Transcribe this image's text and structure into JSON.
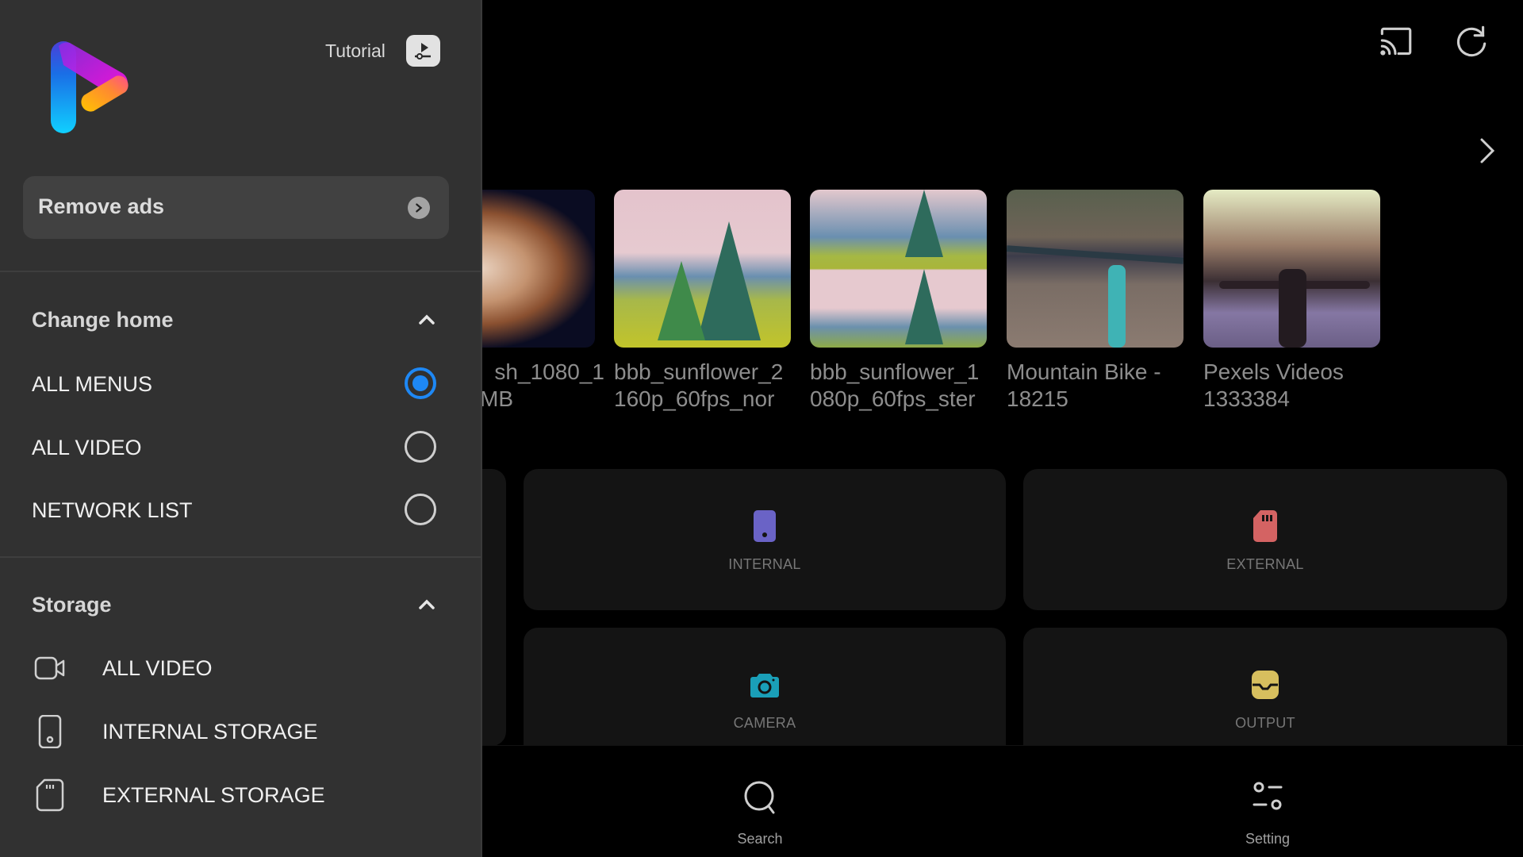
{
  "top_bar": {
    "cast_icon": "cast-icon",
    "refresh_icon": "refresh-icon",
    "next_icon": "chevron-right-icon"
  },
  "recent_videos": [
    {
      "title_line1": "sh_1080_1",
      "title_line2": "MB",
      "thumb": "jellyfish"
    },
    {
      "title_line1": "bbb_sunflower_2",
      "title_line2": "160p_60fps_nor",
      "thumb": "sunflower-landscape"
    },
    {
      "title_line1": "bbb_sunflower_1",
      "title_line2": "080p_60fps_ster",
      "thumb": "sunflower-stereo"
    },
    {
      "title_line1": "Mountain Bike -",
      "title_line2": "18215",
      "thumb": "mountain-bike"
    },
    {
      "title_line1": "Pexels Videos",
      "title_line2": "1333384",
      "thumb": "motorcycle"
    }
  ],
  "storage_cards": [
    {
      "label": "INTERNAL",
      "icon": "phone-storage-icon",
      "color": "#6a63c6"
    },
    {
      "label": "EXTERNAL",
      "icon": "sd-card-icon",
      "color": "#d46363"
    },
    {
      "label": "CAMERA",
      "icon": "camera-icon",
      "color": "#1a9fb8"
    },
    {
      "label": "OUTPUT",
      "icon": "output-tray-icon",
      "color": "#d7bf5e"
    }
  ],
  "bottom_nav": [
    {
      "label": "Search",
      "icon": "search-icon"
    },
    {
      "label": "Setting",
      "icon": "settings-sliders-icon"
    }
  ],
  "sidebar": {
    "tutorial_label": "Tutorial",
    "remove_ads_label": "Remove ads",
    "change_home": {
      "title": "Change home",
      "options": [
        {
          "label": "ALL MENUS",
          "selected": true
        },
        {
          "label": "ALL VIDEO",
          "selected": false
        },
        {
          "label": "NETWORK LIST",
          "selected": false
        }
      ]
    },
    "storage": {
      "title": "Storage",
      "items": [
        {
          "label": "ALL VIDEO",
          "icon": "video-camera-icon"
        },
        {
          "label": "INTERNAL STORAGE",
          "icon": "phone-storage-icon"
        },
        {
          "label": "EXTERNAL STORAGE",
          "icon": "sd-card-icon"
        }
      ]
    }
  },
  "colors": {
    "accent": "#1e88f5",
    "sidebar_bg": "#313131",
    "main_bg": "#000000",
    "card_bg": "#141414"
  }
}
